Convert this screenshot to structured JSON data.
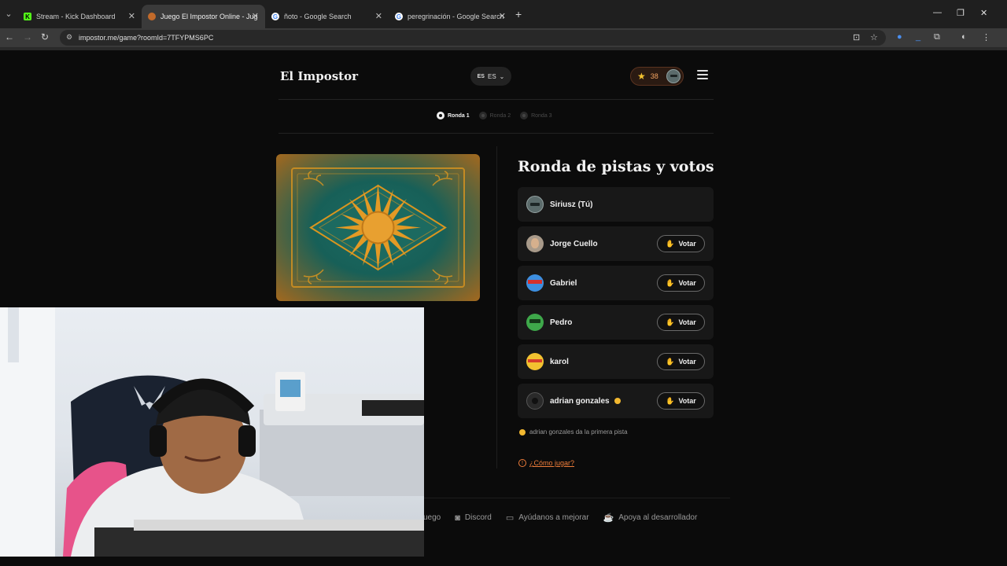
{
  "browser": {
    "tabs": [
      {
        "title": "Stream - Kick Dashboard",
        "favicon": "kick-icon",
        "active": false
      },
      {
        "title": "Juego El Impostor Online - Jug",
        "favicon": "impostor-icon",
        "active": true
      },
      {
        "title": "ñoto - Google Search",
        "favicon": "google-icon",
        "active": false
      },
      {
        "title": "peregrinación - Google Search",
        "favicon": "google-icon",
        "active": false
      }
    ],
    "url": "impostor.me/game?roomId=7TFYPMS6PC"
  },
  "header": {
    "brand": "El Impostor",
    "lang_flag": "ES",
    "lang_label": "ES",
    "score": "38"
  },
  "rounds": [
    {
      "label": "Ronda 1",
      "active": true
    },
    {
      "label": "Ronda 2",
      "active": false
    },
    {
      "label": "Ronda 3",
      "active": false
    }
  ],
  "main": {
    "heading": "Ronda de pistas y votos",
    "vote_label": "Votar",
    "players": [
      {
        "name": "Siriusz (Tú)",
        "avatar": "robot-gray",
        "can_vote": false
      },
      {
        "name": "Jorge Cuello",
        "avatar": "photo",
        "can_vote": true
      },
      {
        "name": "Gabriel",
        "avatar": "robot-blue",
        "can_vote": true
      },
      {
        "name": "Pedro",
        "avatar": "robot-green",
        "can_vote": true
      },
      {
        "name": "karol",
        "avatar": "robot-yellow",
        "can_vote": true
      },
      {
        "name": "adrian gonzales",
        "avatar": "dark",
        "can_vote": true,
        "turn": true
      }
    ],
    "hint": "adrian gonzales da la primera pista",
    "howto": "¿Cómo jugar?"
  },
  "footer": {
    "items": [
      {
        "label": "uego",
        "icon": "game-icon"
      },
      {
        "label": "Discord",
        "icon": "discord-icon"
      },
      {
        "label": "Ayúdanos a mejorar",
        "icon": "feedback-icon"
      },
      {
        "label": "Apoya al desarrollador",
        "icon": "coffee-icon"
      }
    ]
  },
  "colors": {
    "accent_orange": "#ef7d3a",
    "star": "#f2c230",
    "card_teal": "#176058",
    "card_gold": "#d9951f"
  }
}
